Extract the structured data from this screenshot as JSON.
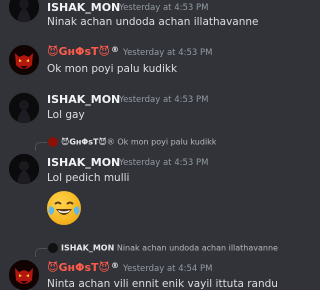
{
  "messages": [
    {
      "user": "ISHAK_MON",
      "time": "Yesterday at 4:53 PM",
      "text": "Ninak achan undoda achan illathavanne"
    },
    {
      "user": "😈GнΦsT😈",
      "badge": "®",
      "time": "Yesterday at 4:53 PM",
      "text": "Ok mon poyi palu kudikk"
    },
    {
      "user": "ISHAK_MON",
      "time": "Yesterday at 4:53 PM",
      "text": "Lol gay"
    },
    {
      "reply_user": "😈GнΦsT😈",
      "reply_badge": "®",
      "reply_text": "Ok mon poyi palu kudikk",
      "user": "ISHAK_MON",
      "time": "Yesterday at 4:53 PM",
      "text": "Lol pedich mulli",
      "emoji": "laughing-tears"
    },
    {
      "reply_user": "ISHAK_MON",
      "reply_text": "Ninak achan undoda achan illathavanne",
      "user": "😈GнΦsT😈",
      "badge": "®",
      "time": "Yesterday at 4:54 PM",
      "text": "Ninta achan vili ennit enik vayil ittuta randu"
    }
  ],
  "colors": {
    "background": "#313338",
    "ghost_name": "#ff5b4c",
    "text": "#dbdee1",
    "timestamp": "#949ba4"
  },
  "icons": {
    "emoji": "face-with-tears-of-joy",
    "avatar_ghost": "red-devil-mask"
  }
}
